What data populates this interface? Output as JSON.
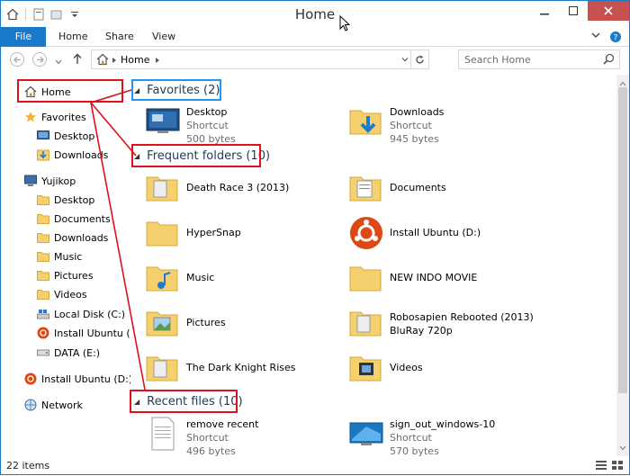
{
  "window": {
    "title": "Home"
  },
  "ribbon": {
    "tabs": [
      "File",
      "Home",
      "Share",
      "View"
    ]
  },
  "address": {
    "path": "Home",
    "search_placeholder": "Search Home"
  },
  "nav": {
    "home": "Home",
    "favorites": "Favorites",
    "fav_desktop": "Desktop",
    "fav_downloads": "Downloads",
    "user": "Yujikop",
    "u_desktop": "Desktop",
    "u_documents": "Documents",
    "u_downloads": "Downloads",
    "u_music": "Music",
    "u_pictures": "Pictures",
    "u_videos": "Videos",
    "u_localdisk": "Local Disk (C:)",
    "u_ubuntu": "Install Ubuntu (D:",
    "u_data": "DATA (E:)",
    "ubuntu_drive": "Install Ubuntu (D:)",
    "network": "Network"
  },
  "groups": {
    "favorites": "Favorites (2)",
    "frequent": "Frequent folders (10)",
    "recent": "Recent files (10)"
  },
  "favorites": [
    {
      "name": "Desktop",
      "type": "Shortcut",
      "size": "500 bytes"
    },
    {
      "name": "Downloads",
      "type": "Shortcut",
      "size": "945 bytes"
    }
  ],
  "frequent": [
    {
      "name": "Death Race 3 (2013)"
    },
    {
      "name": "Documents"
    },
    {
      "name": "HyperSnap"
    },
    {
      "name": "Install Ubuntu (D:)"
    },
    {
      "name": "Music"
    },
    {
      "name": "NEW INDO MOVIE"
    },
    {
      "name": "Pictures"
    },
    {
      "name": "Robosapien Rebooted (2013)",
      "line2": "BluRay 720p"
    },
    {
      "name": "The Dark Knight Rises"
    },
    {
      "name": "Videos"
    }
  ],
  "recent": [
    {
      "name": "remove recent",
      "type": "Shortcut",
      "size": "496 bytes"
    },
    {
      "name": "sign_out_windows-10",
      "type": "Shortcut",
      "size": "570 bytes"
    }
  ],
  "status": {
    "count": "22 items"
  },
  "colors": {
    "accent": "#1979ca",
    "annotation_red": "#e0101a",
    "annotation_blue": "#2196f3",
    "folder": "#f5d06f"
  }
}
